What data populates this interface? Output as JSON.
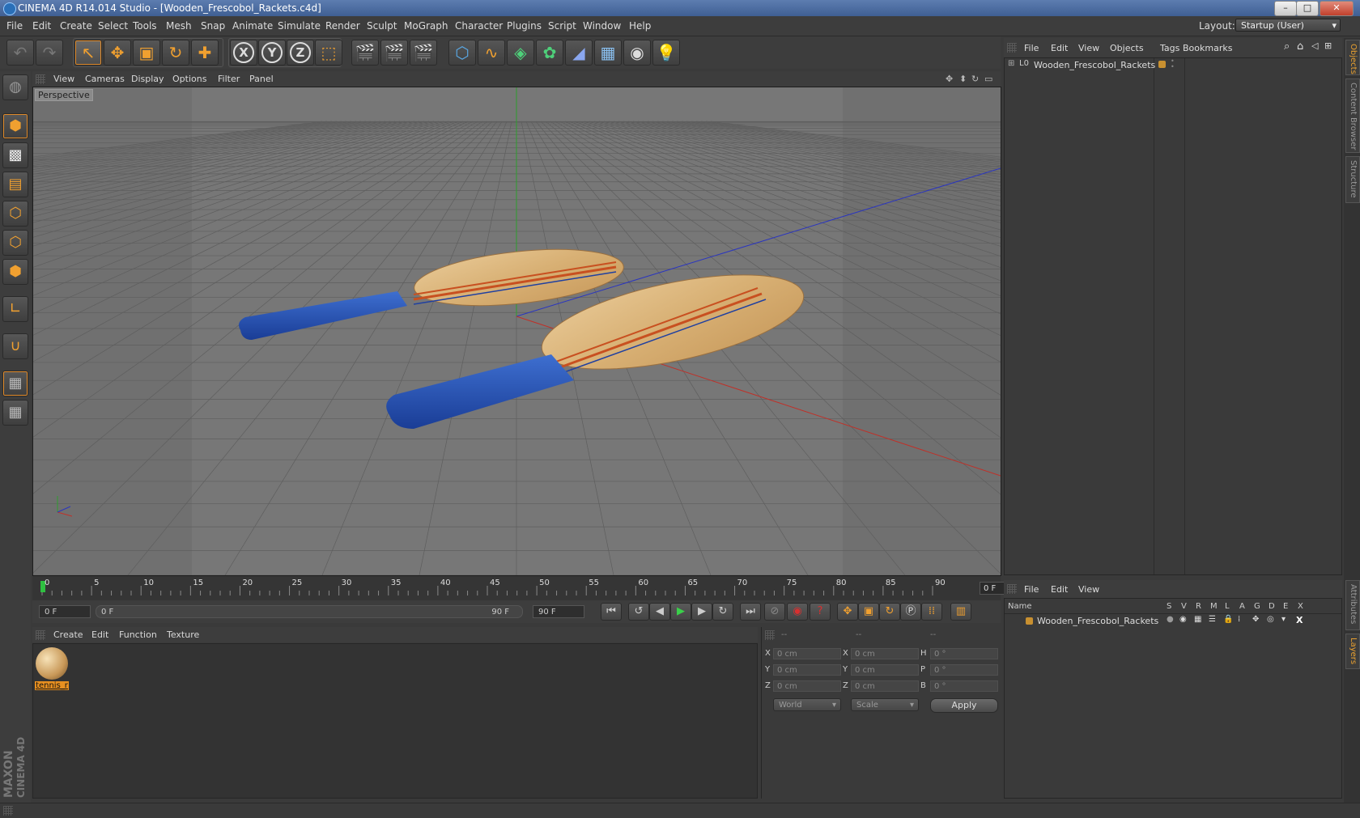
{
  "window": {
    "title": "CINEMA 4D R14.014 Studio - [Wooden_Frescobol_Rackets.c4d]",
    "minimize": "–",
    "maximize": "□",
    "close": "✕"
  },
  "menubar": {
    "items": [
      "File",
      "Edit",
      "Create",
      "Select",
      "Tools",
      "Mesh",
      "Snap",
      "Animate",
      "Simulate",
      "Render",
      "Sculpt",
      "MoGraph",
      "Character",
      "Plugins",
      "Script",
      "Window",
      "Help"
    ],
    "layout_label": "Layout:",
    "layout_value": "Startup (User)"
  },
  "viewport": {
    "menu": [
      "View",
      "Cameras",
      "Display",
      "Options",
      "Filter",
      "Panel"
    ],
    "label": "Perspective"
  },
  "timeline": {
    "ticks": [
      "0",
      "5",
      "10",
      "15",
      "20",
      "25",
      "30",
      "35",
      "40",
      "45",
      "50",
      "55",
      "60",
      "65",
      "70",
      "75",
      "80",
      "85",
      "90"
    ],
    "current_frame": "0 F"
  },
  "transport": {
    "start_field": "0 F",
    "range_start": "0 F",
    "range_end": "90 F",
    "end_field": "90 F"
  },
  "material_manager": {
    "menu": [
      "Create",
      "Edit",
      "Function",
      "Texture"
    ],
    "material_name": "tennis_r"
  },
  "coordinates": {
    "header": [
      "--",
      "--",
      "--"
    ],
    "rows": [
      {
        "a": "X",
        "av": "0 cm",
        "b": "X",
        "bv": "0 cm",
        "c": "H",
        "cv": "0 °"
      },
      {
        "a": "Y",
        "av": "0 cm",
        "b": "Y",
        "bv": "0 cm",
        "c": "P",
        "cv": "0 °"
      },
      {
        "a": "Z",
        "av": "0 cm",
        "b": "Z",
        "bv": "0 cm",
        "c": "B",
        "cv": "0 °"
      }
    ],
    "space": "World",
    "mode": "Scale",
    "apply": "Apply"
  },
  "object_manager": {
    "menu": [
      "File",
      "Edit",
      "View",
      "Objects",
      "Tags",
      "Bookmarks"
    ],
    "object_name": "Wooden_Frescobol_Rackets"
  },
  "layer_manager": {
    "menu": [
      "File",
      "Edit",
      "View"
    ],
    "columns": [
      "Name",
      "S",
      "V",
      "R",
      "M",
      "L",
      "A",
      "G",
      "D",
      "E",
      "X"
    ],
    "layer_name": "Wooden_Frescobol_Rackets"
  },
  "side_tabs": [
    "Objects",
    "Content Browser",
    "Structure",
    "Attributes",
    "Layers"
  ],
  "brand": {
    "maxon": "MAXON",
    "cinema": "CINEMA 4D"
  },
  "colors": {
    "accent": "#e89020",
    "x_axis": "#c8302a",
    "y_axis": "#2aa02a",
    "z_axis": "#2a3ac8"
  }
}
